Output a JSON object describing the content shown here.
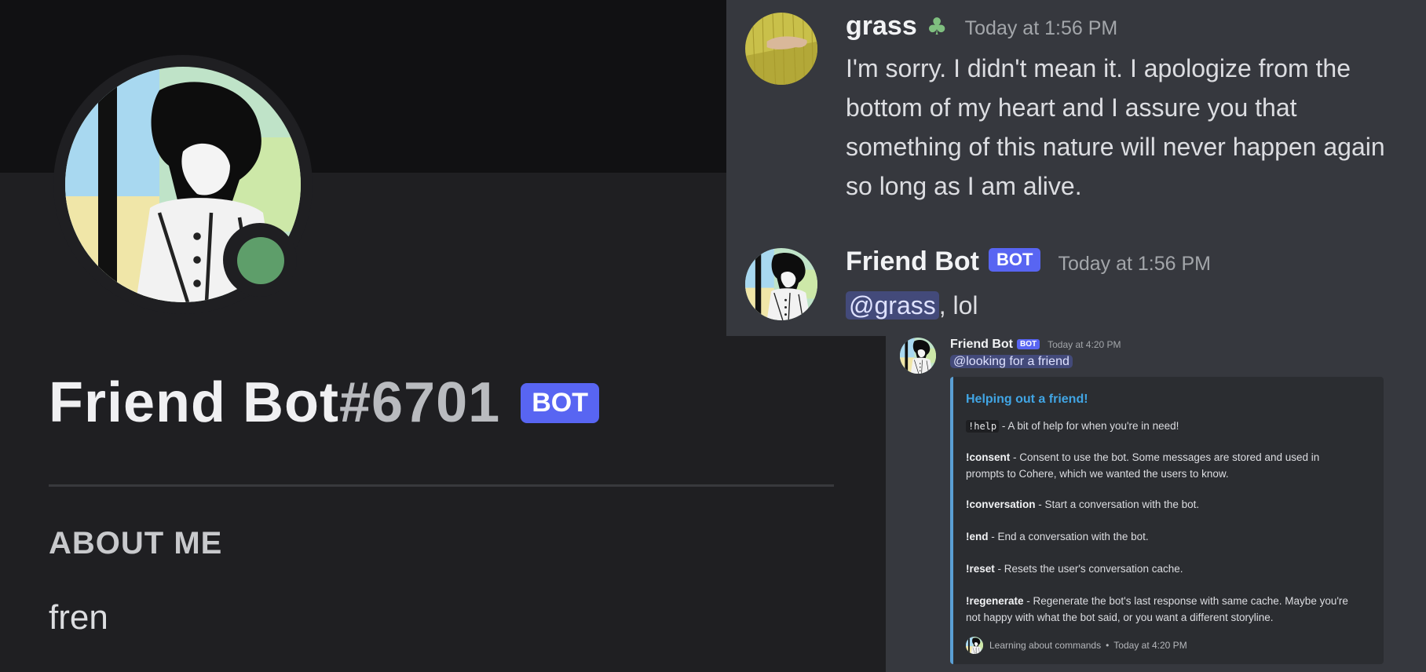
{
  "profile": {
    "username": "Friend Bot",
    "discriminator": "#6701",
    "bot_badge": "BOT",
    "about_title": "ABOUT ME",
    "about_text": "fren",
    "status_color": "#5e9e6a"
  },
  "chat": {
    "messages": [
      {
        "username": "grass",
        "badge_icon": "sprout-icon",
        "timestamp": "Today at 1:56 PM",
        "text": "I'm sorry. I didn't mean it. I apologize from the bottom of my heart and I assure you that something of this nature will never happen again so long as I am alive."
      },
      {
        "username": "Friend Bot",
        "badge": "BOT",
        "timestamp": "Today at 1:56 PM",
        "mention": "@grass",
        "text": ", lol"
      }
    ]
  },
  "embed_message": {
    "username": "Friend Bot",
    "badge": "BOT",
    "timestamp": "Today at 4:20 PM",
    "mention": "@looking for a friend",
    "embed": {
      "title": "Helping out a friend!",
      "accent_color": "#5a9fd4",
      "commands": [
        {
          "name": "!help",
          "desc": " - A bit of help for when you're in need!"
        },
        {
          "name": "!consent",
          "desc": " - Consent to use the bot. Some messages are stored and used in prompts to Cohere, which we wanted the users to know."
        },
        {
          "name": "!conversation",
          "desc": " - Start a conversation with the bot."
        },
        {
          "name": "!end",
          "desc": " - End a conversation with the bot."
        },
        {
          "name": "!reset",
          "desc": " - Resets the user's conversation cache."
        },
        {
          "name": "!regenerate",
          "desc": " - Regenerate the bot's last response with same cache. Maybe you're not happy with what the bot said, or you want a different storyline."
        }
      ],
      "footer_text": "Learning about commands",
      "footer_timestamp": "Today at 4:20 PM"
    }
  },
  "colors": {
    "discord_blurple": "#5865f2",
    "chat_bg": "#36383e",
    "embed_bg": "#2b2d31"
  }
}
